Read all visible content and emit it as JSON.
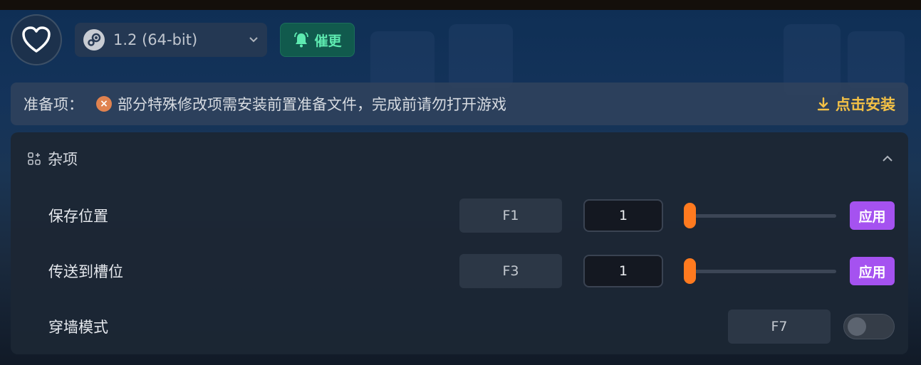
{
  "header": {
    "favorite_icon": "heart-icon",
    "version": {
      "label": "1.2 (64-bit)",
      "icon": "steam-icon"
    },
    "urge_button": {
      "label": "催更",
      "icon": "bell-icon"
    }
  },
  "prereq": {
    "title": "准备项：",
    "message": "部分特殊修改项需安装前置准备文件，完成前请勿打开游戏",
    "install_label": "点击安装",
    "status_icon": "x-circle-icon"
  },
  "panel": {
    "title": "杂项",
    "title_icon": "apps-add-icon",
    "rows": [
      {
        "name": "保存位置",
        "hotkey": "F1",
        "value": "1",
        "slider_level": 0,
        "apply_label": "应用"
      },
      {
        "name": "传送到槽位",
        "hotkey": "F3",
        "value": "1",
        "slider_level": 0,
        "apply_label": "应用"
      },
      {
        "name": "穿墙模式",
        "hotkey": "F7",
        "toggle_on": false
      }
    ]
  },
  "colors": {
    "accent_orange": "#ff7a1f",
    "apply_purple": "#a552f0",
    "install_yellow": "#f2c046",
    "urge_green": "#5eeab0"
  }
}
